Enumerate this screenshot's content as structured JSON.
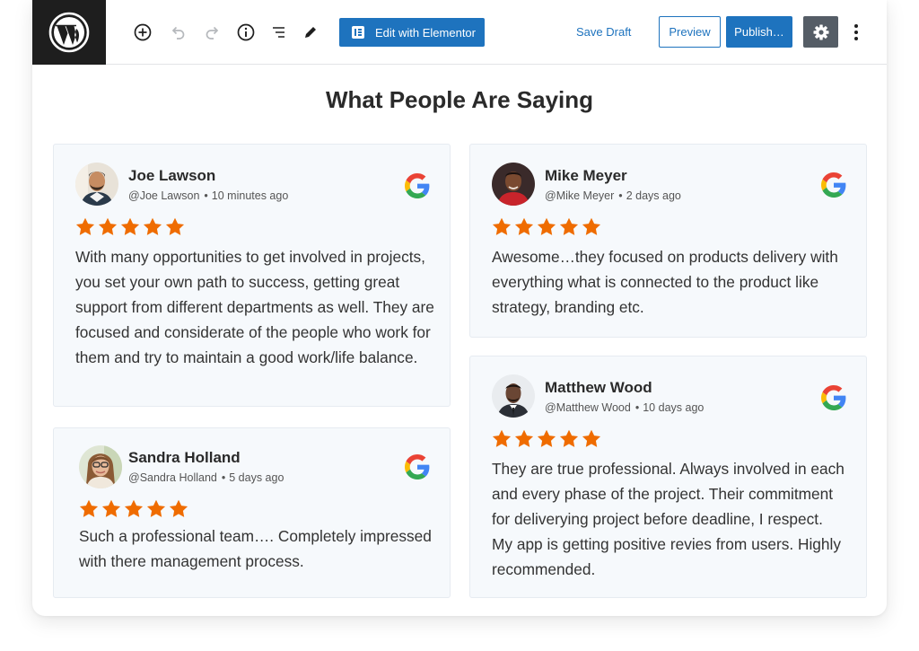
{
  "toolbar": {
    "elementor_label": "Edit with Elementor",
    "save_draft_label": "Save Draft",
    "preview_label": "Preview",
    "publish_label": "Publish…"
  },
  "page": {
    "title": "What People Are Saying"
  },
  "reviews": [
    {
      "name": "Joe Lawson",
      "handle": "@Joe Lawson",
      "time": "10 minutes ago",
      "rating": 5,
      "text": "With many opportunities to get involved in projects, you set your own path to success, getting great support from different departments as well. They are focused and considerate of the people who work for them and try to maintain a good work/life balance."
    },
    {
      "name": "Sandra Holland",
      "handle": "@Sandra Holland",
      "time": "5 days ago",
      "rating": 5,
      "text": "Such a professional team…. Completely impressed with there management process."
    },
    {
      "name": "Mike Meyer",
      "handle": "@Mike Meyer",
      "time": "2 days ago",
      "rating": 5,
      "text": "Awesome…they focused on products delivery with everything what is connected to the product like strategy, branding etc."
    },
    {
      "name": "Matthew Wood",
      "handle": "@Matthew Wood",
      "time": "10 days ago",
      "rating": 5,
      "text": "They are true professional. Always involved in each and every phase of the project. Their commitment for deliverying project before deadline, I respect. My app is getting positive revies from users. Highly recommended."
    }
  ],
  "colors": {
    "accent": "#1e73be",
    "star": "#ef6c00",
    "card_bg": "#f6f9fc",
    "toolbar_logo_bg": "#1e1e1e",
    "settings_bg": "#555d66"
  }
}
